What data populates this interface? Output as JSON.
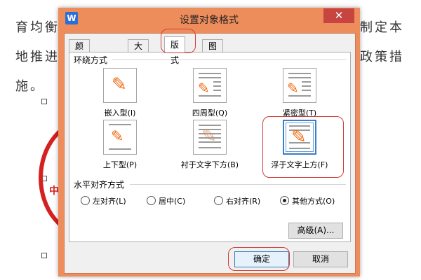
{
  "document": {
    "line1": "育均衡",
    "line1_right": "制定本",
    "line2": "地推进",
    "line2_right": "政策措",
    "line3": "施。",
    "stamp_char": "中"
  },
  "dialog": {
    "title": "设置对象格式",
    "app_icon": "W",
    "close_glyph": "✕",
    "tabs": [
      {
        "label": "颜色与线条"
      },
      {
        "label": "大小"
      },
      {
        "label": "版式"
      },
      {
        "label": "图片"
      }
    ],
    "wrap_group_label": "环绕方式",
    "wrap_options": [
      {
        "label": "嵌入型(I)"
      },
      {
        "label": "四周型(Q)"
      },
      {
        "label": "紧密型(T)"
      },
      {
        "label": "上下型(P)"
      },
      {
        "label": "衬于文字下方(B)"
      },
      {
        "label": "浮于文字上方(F)"
      }
    ],
    "align_group_label": "水平对齐方式",
    "align_options": [
      {
        "label": "左对齐(L)"
      },
      {
        "label": "居中(C)"
      },
      {
        "label": "右对齐(R)"
      },
      {
        "label": "其他方式(O)"
      }
    ],
    "advanced_label": "高级(A)...",
    "ok_label": "确定",
    "cancel_label": "取消"
  },
  "colors": {
    "dialog_frame": "#ee8d5c",
    "annotation": "#d43b3b",
    "close_button": "#c74440",
    "selected_border": "#3b7fc4"
  }
}
